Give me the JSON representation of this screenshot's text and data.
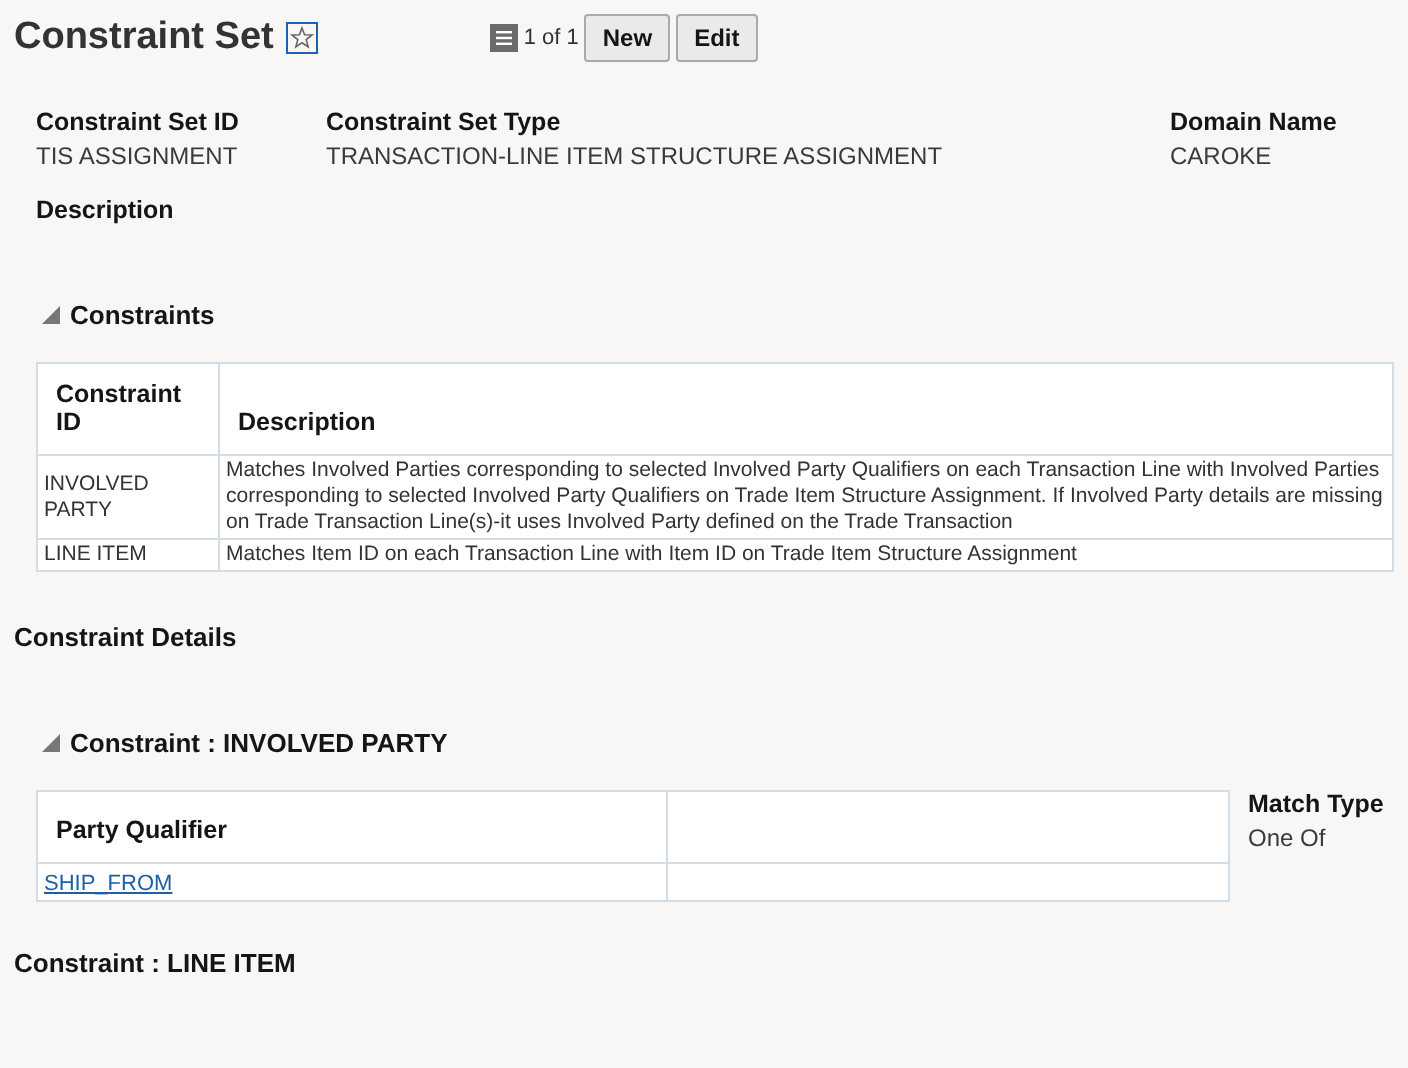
{
  "header": {
    "title": "Constraint Set",
    "record_count": "1 of 1",
    "buttons": [
      "New",
      "Edit"
    ]
  },
  "fields": [
    {
      "label": "Constraint Set ID",
      "value": "TIS ASSIGNMENT"
    },
    {
      "label": "Constraint Set Type",
      "value": "TRANSACTION-LINE ITEM STRUCTURE ASSIGNMENT"
    },
    {
      "label": "Domain Name",
      "value": "CAROKE"
    }
  ],
  "description_label": "Description",
  "constraints": {
    "title": "Constraints",
    "expanded": true,
    "columns": [
      "Constraint ID",
      "Description"
    ],
    "rows": [
      [
        "INVOLVED PARTY",
        "Matches Involved Parties corresponding to selected Involved Party Qualifiers on each Transaction Line with Involved Parties corresponding to selected Involved Party Qualifiers on Trade Item Structure Assignment. If Involved Party details are missing on Trade Transaction Line(s)-it uses Involved Party defined on the Trade Transaction"
      ],
      [
        "LINE ITEM",
        "Matches Item ID on each Transaction Line with Item ID on Trade Item Structure Assignment"
      ]
    ]
  },
  "details_title": "Constraint Details",
  "details": [
    {
      "title": "Constraint : INVOLVED PARTY",
      "expanded": true,
      "column": "Party Qualifier",
      "rows": [
        "SHIP_FROM"
      ],
      "match_label": "Match Type",
      "match_value": "One Of"
    },
    {
      "title": "Constraint : LINE ITEM"
    }
  ]
}
